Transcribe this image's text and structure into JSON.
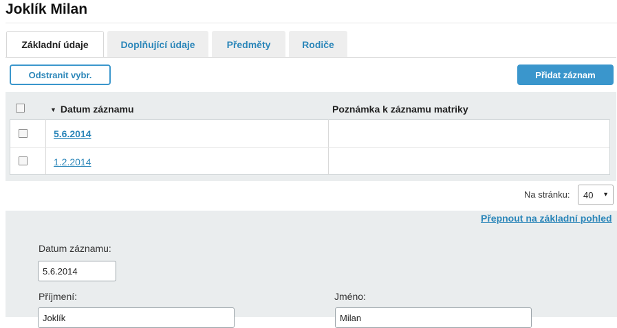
{
  "page": {
    "title": "Joklík Milan"
  },
  "tabs": [
    {
      "label": "Základní údaje",
      "active": true
    },
    {
      "label": "Doplňující údaje",
      "active": false
    },
    {
      "label": "Předměty",
      "active": false
    },
    {
      "label": "Rodiče",
      "active": false
    }
  ],
  "toolbar": {
    "delete_selected_label": "Odstranit vybr.",
    "add_record_label": "Přidat záznam"
  },
  "table": {
    "sort_indicator": "▼",
    "columns": [
      "Datum záznamu",
      "Poznámka k záznamu matriky"
    ],
    "rows": [
      {
        "date": "5.6.2014",
        "note": "",
        "selected": true
      },
      {
        "date": "1.2.2014",
        "note": "",
        "selected": false
      }
    ]
  },
  "pagination": {
    "per_page_label": "Na stránku:",
    "per_page_value": "40"
  },
  "form": {
    "switch_view_label": "Přepnout na základní pohled",
    "date_label": "Datum záznamu:",
    "date_value": "5.6.2014",
    "surname_label": "Příjmení:",
    "surname_value": "Joklík",
    "name_label": "Jméno:",
    "name_value": "Milan"
  },
  "colors": {
    "accent": "#3a96cc",
    "link": "#2b86b9",
    "panel_bg": "#eaedee"
  },
  "icons": {
    "sort": "sort-desc-icon",
    "select_caret": "chevron-down-icon"
  }
}
